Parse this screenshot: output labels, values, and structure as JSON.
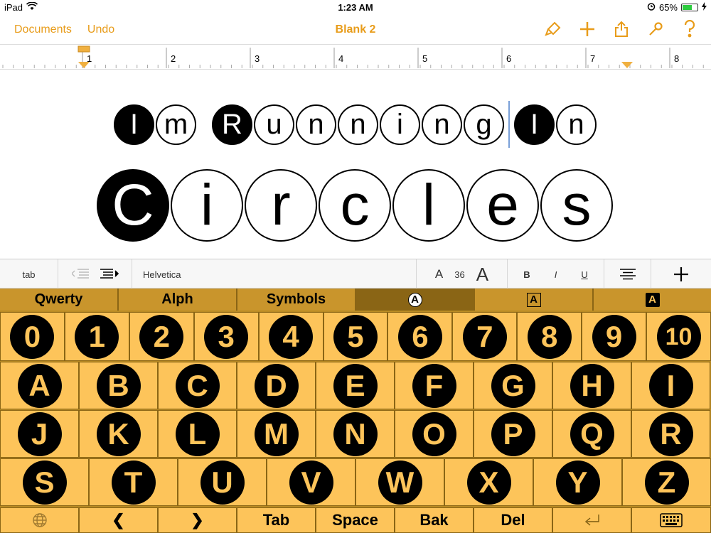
{
  "status": {
    "device": "iPad",
    "time": "1:23 AM",
    "battery": "65%"
  },
  "nav": {
    "documents": "Documents",
    "undo": "Undo",
    "title": "Blank 2"
  },
  "ruler": {
    "labels": [
      "1",
      "2",
      "3",
      "4",
      "5",
      "6",
      "7",
      "8"
    ]
  },
  "document": {
    "line1": [
      "I",
      "m",
      "R",
      "u",
      "n",
      "n",
      "i",
      "n",
      "g",
      "I",
      "n"
    ],
    "line2": [
      "C",
      "i",
      "r",
      "c",
      "l",
      "e",
      "s"
    ]
  },
  "format": {
    "tab": "tab",
    "font": "Helvetica",
    "size": "36",
    "bold": "B",
    "italic": "I",
    "underline": "U",
    "smaller": "A",
    "larger": "A"
  },
  "keyboard": {
    "tabs": [
      "Qwerty",
      "Alph",
      "Symbols",
      "A",
      "A",
      "A"
    ],
    "numbers": [
      "0",
      "1",
      "2",
      "3",
      "4",
      "5",
      "6",
      "7",
      "8",
      "9",
      "10"
    ],
    "row1": [
      "A",
      "B",
      "C",
      "D",
      "E",
      "F",
      "G",
      "H",
      "I"
    ],
    "row2": [
      "J",
      "K",
      "L",
      "M",
      "N",
      "O",
      "P",
      "Q",
      "R"
    ],
    "row3": [
      "S",
      "T",
      "U",
      "V",
      "W",
      "X",
      "Y",
      "Z"
    ],
    "bottom": {
      "prev": "❮",
      "next": "❯",
      "tab": "Tab",
      "space": "Space",
      "bak": "Bak",
      "del": "Del"
    }
  },
  "colors": {
    "accent": "#e89c1a",
    "key": "#fdc45a",
    "keyboard_bg": "#b88a24",
    "active_tab": "#8a6515"
  }
}
